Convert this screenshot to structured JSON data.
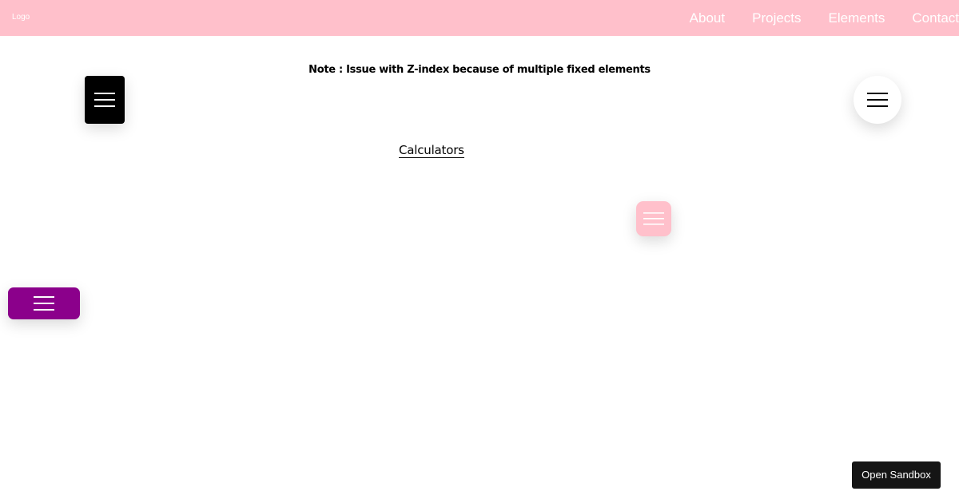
{
  "navbar": {
    "logo": "Logo",
    "links": [
      "About",
      "Projects",
      "Elements",
      "Contact"
    ]
  },
  "main": {
    "note": "Note : Issue with Z-index because of multiple fixed elements",
    "link_label": "Calculators"
  },
  "menu_buttons": [
    {
      "icon": "hamburger-icon",
      "bg": "#000000",
      "line": "#ffffff"
    },
    {
      "icon": "hamburger-icon",
      "bg": "#ffffff",
      "line": "#000000"
    },
    {
      "icon": "hamburger-icon",
      "bg": "#ffc0cb",
      "line": "#ffffff"
    },
    {
      "icon": "hamburger-icon",
      "bg": "#8b008b",
      "line": "#ffffff"
    }
  ],
  "sandbox": {
    "label": "Open Sandbox"
  },
  "colors": {
    "navbar_bg": "#ffc0cb",
    "nav_text": "#ffffff",
    "sandbox_bg": "#151515"
  }
}
